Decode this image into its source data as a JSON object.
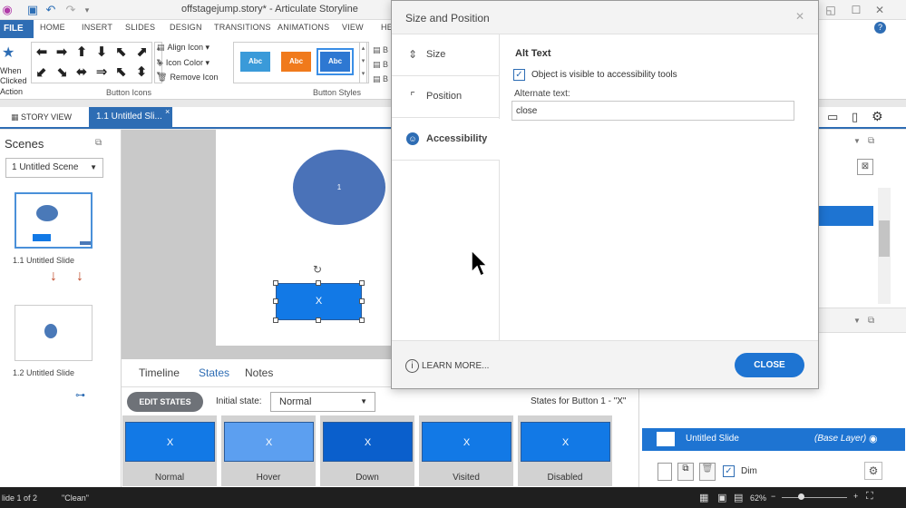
{
  "window": {
    "title": "offstagejump.story* - Articulate Storyline",
    "controls": [
      "minimize-icon",
      "restore-icon",
      "close-icon",
      "help-icon"
    ]
  },
  "ribbon": {
    "file": "FILE",
    "tabs": [
      "HOME",
      "INSERT",
      "SLIDES",
      "DESIGN",
      "TRANSITIONS",
      "ANIMATIONS",
      "VIEW",
      "HE"
    ],
    "when_clicked": [
      "When",
      "Clicked",
      "Action"
    ],
    "button_icons_label": "Button Icons",
    "align_icon": "Align Icon",
    "icon_color": "Icon Color",
    "remove_icon": "Remove Icon",
    "button_styles_label": "Button Styles",
    "styles": [
      {
        "label": "Abc",
        "color": "#3a9ad9"
      },
      {
        "label": "Abc",
        "color": "#f07a1c"
      },
      {
        "label": "Abc",
        "color": "#2e78d2"
      }
    ]
  },
  "viewtabs": {
    "story_view": "STORY VIEW",
    "slide_tab": "1.1 Untitled Sli..."
  },
  "scenes": {
    "title": "Scenes",
    "selected_scene": "1 Untitled Scene",
    "slides": [
      {
        "label": "1.1 Untitled Slide"
      },
      {
        "label": "1.2 Untitled Slide"
      }
    ]
  },
  "canvas": {
    "oval_label": "1",
    "button_label": "X"
  },
  "states_panel": {
    "tabs": [
      "Timeline",
      "States",
      "Notes"
    ],
    "edit_states": "EDIT STATES",
    "initial_state_label": "Initial state:",
    "initial_state_value": "Normal",
    "states_for": "States for Button 1 - \"X\"",
    "states": [
      {
        "name": "Normal",
        "color": "#1279e6"
      },
      {
        "name": "Hover",
        "color": "#5c9ff0"
      },
      {
        "name": "Down",
        "color": "#0a5fcc"
      },
      {
        "name": "Visited",
        "color": "#1279e6"
      },
      {
        "name": "Disabled",
        "color": "#1279e6"
      }
    ]
  },
  "layers": {
    "slide_layer": "Untitled Slide",
    "base_layer": "(Base Layer)",
    "dim": "Dim"
  },
  "status": {
    "slide_of": "lide 1 of 2",
    "clean": "\"Clean\"",
    "zoom": "62%"
  },
  "dialog": {
    "title": "Size and Position",
    "nav": [
      "Size",
      "Position",
      "Accessibility"
    ],
    "alt_text_title": "Alt Text",
    "visible_label": "Object is visible to accessibility tools",
    "visible_checked": true,
    "alternate_text_label": "Alternate text:",
    "alternate_text_value": "close",
    "learn_more": "LEARN MORE...",
    "close": "CLOSE"
  }
}
